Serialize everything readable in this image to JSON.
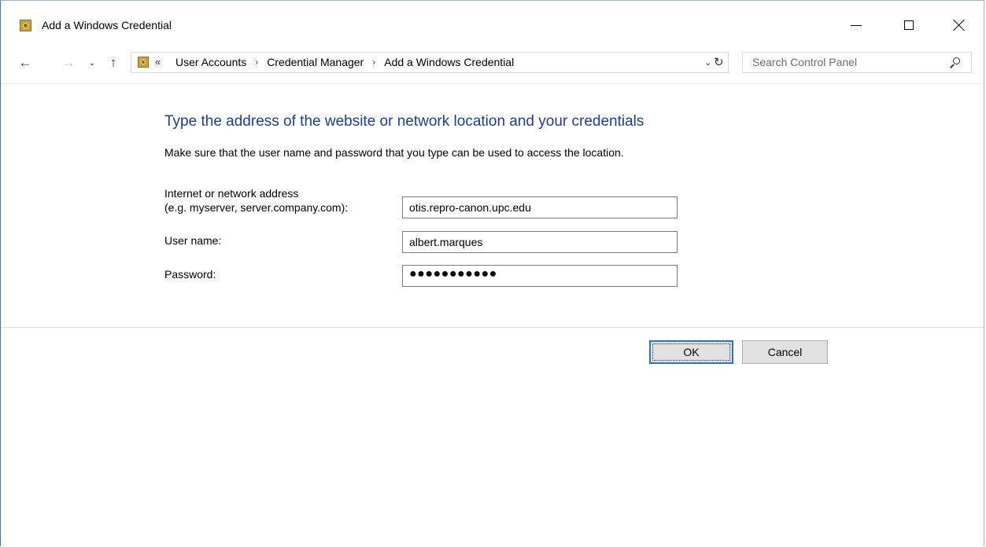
{
  "window": {
    "title": "Add a Windows Credential"
  },
  "nav": {
    "back_icon": "←",
    "forward_icon": "→",
    "recent_icon": "⌄",
    "up_icon": "↑",
    "overflow": "«",
    "breadcrumbs": [
      "User Accounts",
      "Credential Manager",
      "Add a Windows Credential"
    ],
    "separator": "›",
    "dropdown_icon": "⌄",
    "refresh_icon": "↻"
  },
  "search": {
    "placeholder": "Search Control Panel"
  },
  "form": {
    "heading": "Type the address of the website or network location and your credentials",
    "instruction": "Make sure that the user name and password that you type can be used to access the location.",
    "address_label_line1": "Internet or network address",
    "address_label_line2": "(e.g. myserver, server.company.com):",
    "address_value": "otis.repro-canon.upc.edu",
    "username_label": "User name:",
    "username_value": "albert.marques",
    "password_label": "Password:",
    "password_mask": "●●●●●●●●●●●"
  },
  "buttons": {
    "ok": "OK",
    "cancel": "Cancel"
  },
  "colors": {
    "heading": "#1e3c9c",
    "focus_border": "#2b73c8"
  }
}
